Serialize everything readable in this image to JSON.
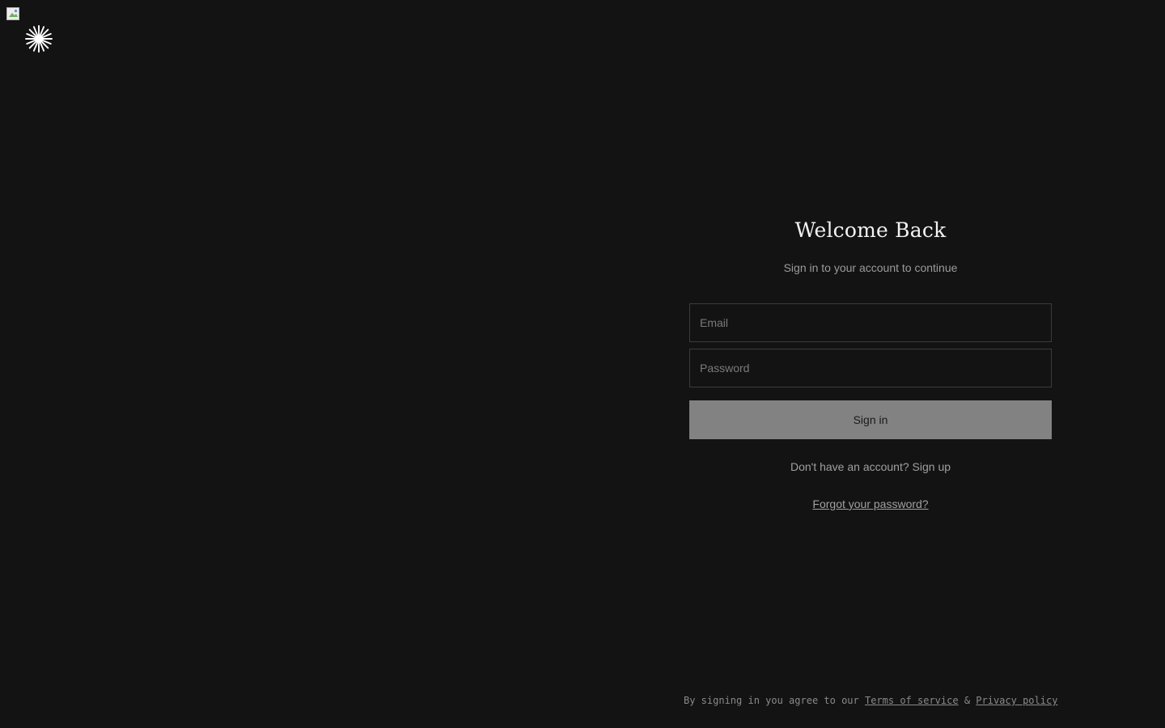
{
  "logo": {
    "icon": "starburst-logo-icon",
    "color": "#ffffff"
  },
  "auth": {
    "title": "Welcome Back",
    "subtitle": "Sign in to your account to continue",
    "email_placeholder": "Email",
    "password_placeholder": "Password",
    "signin_label": "Sign in",
    "no_account_text": "Don't have an account?",
    "signup_label": "Sign up",
    "forgot_label": "Forgot your password?"
  },
  "legal": {
    "prefix": "By signing in you agree to our",
    "terms_label": "Terms of service",
    "ampersand": "&",
    "privacy_label": "Privacy policy"
  },
  "colors": {
    "background": "#131313",
    "button": "#828282",
    "text_primary": "#f2f2f2",
    "text_muted": "#9b9b9b"
  }
}
